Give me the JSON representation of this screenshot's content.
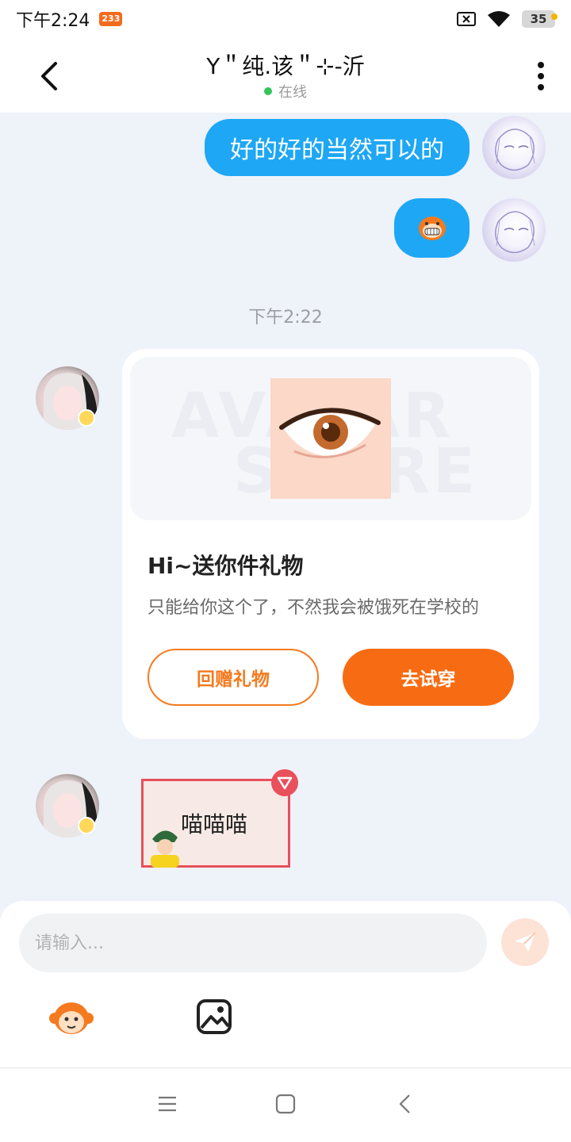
{
  "status_bar": {
    "time": "下午2:24",
    "app_badge": "233",
    "battery": "35"
  },
  "header": {
    "title": "Y＂纯.该＂⊹-沂",
    "status": "在线"
  },
  "messages": {
    "me_text": "好的好的当然可以的",
    "timestamp": "下午2:22",
    "gift_card": {
      "title": "Hi~送你件礼物",
      "description": "只能给你这个了，不然我会被饿死在学校的",
      "return_gift_label": "回赠礼物",
      "try_on_label": "去试穿",
      "watermark_top": "AVATAR",
      "watermark_bottom": "STORE"
    },
    "sticker_text": "喵喵喵"
  },
  "input": {
    "placeholder": "请输入..."
  },
  "colors": {
    "accent_blue": "#1ea7f5",
    "accent_orange": "#f76c12",
    "online_green": "#33c45a"
  },
  "icons": {
    "back": "chevron-left-icon",
    "more": "more-vertical-icon",
    "send": "paper-plane-icon",
    "emoji": "monkey-emoji-icon",
    "image": "image-icon"
  }
}
